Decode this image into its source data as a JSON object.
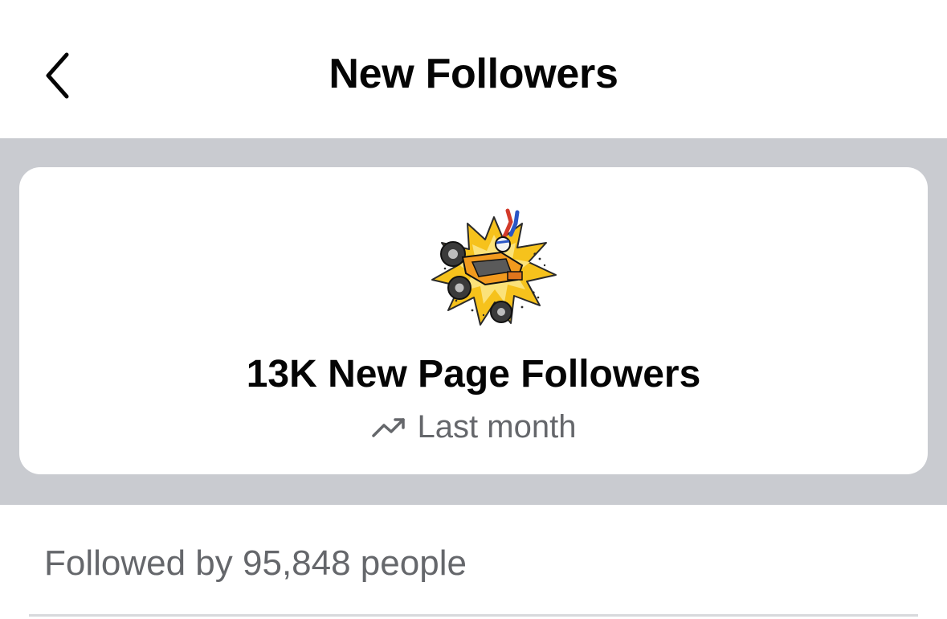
{
  "header": {
    "title": "New Followers"
  },
  "summary_card": {
    "headline": "13K New Page Followers",
    "period_label": "Last month",
    "trend_icon": "trending-up-icon",
    "avatar_icon": "atv-stunt-page-avatar"
  },
  "followers": {
    "followed_by_text": "Followed by 95,848 people"
  },
  "colors": {
    "band_gray": "#c9cbd0",
    "secondary_text": "#65676b",
    "primary_text": "#050505"
  }
}
